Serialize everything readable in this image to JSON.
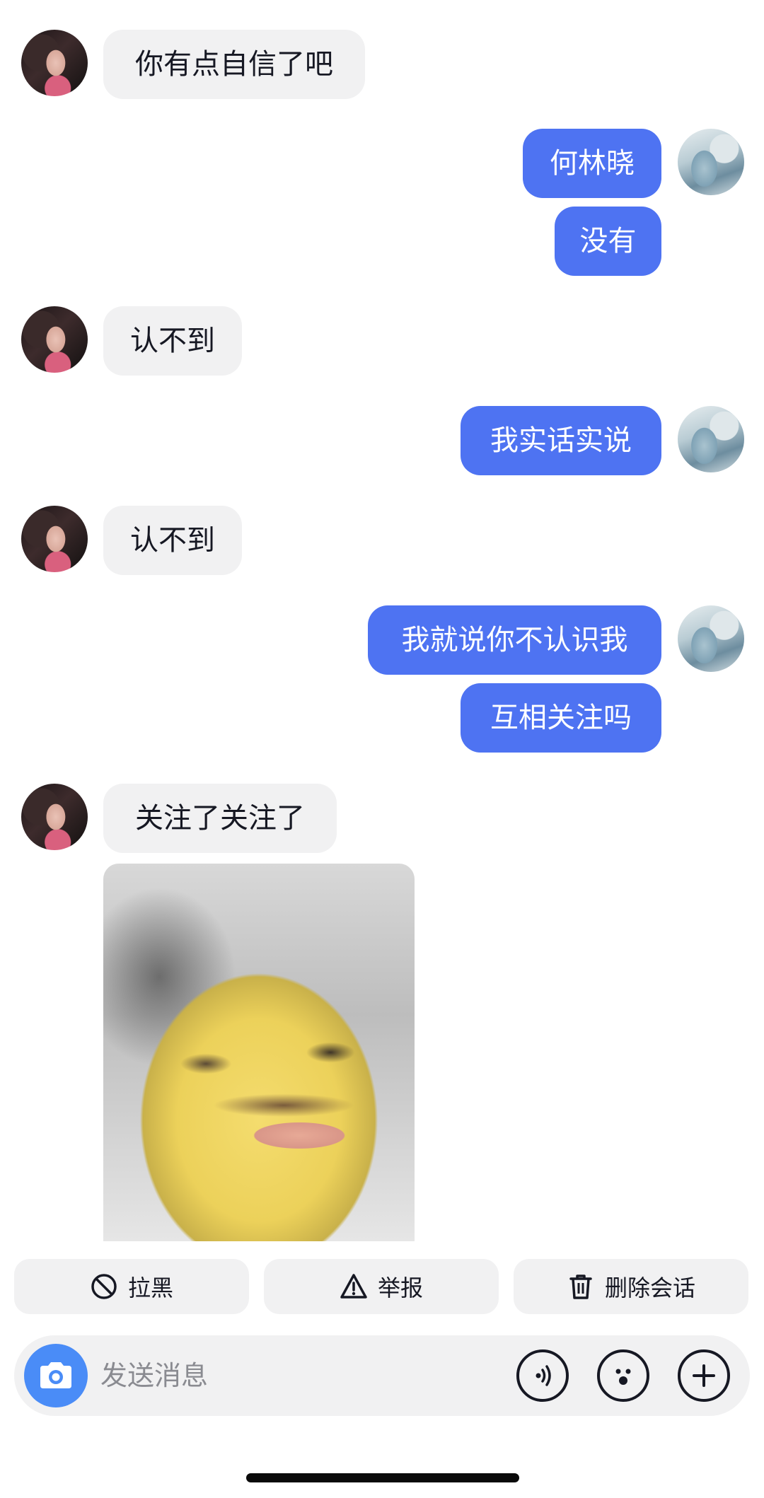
{
  "conversation": {
    "messages": [
      {
        "side": "in",
        "text": "你有点自信了吧"
      },
      {
        "side": "out",
        "text": "何林晓"
      },
      {
        "side": "out",
        "text": "没有"
      },
      {
        "side": "in",
        "text": "认不到"
      },
      {
        "side": "out",
        "text": "我实话实说"
      },
      {
        "side": "in",
        "text": "认不到"
      },
      {
        "side": "out",
        "text": "我就说你不认识我"
      },
      {
        "side": "out",
        "text": "互相关注吗"
      },
      {
        "side": "in",
        "text": "关注了关注了"
      }
    ],
    "sticker": {
      "icon": "yellow-face-sticker"
    }
  },
  "actions": {
    "block_label": "拉黑",
    "report_label": "举报",
    "delete_label": "删除会话"
  },
  "composer": {
    "placeholder": "发送消息"
  },
  "colors": {
    "outgoing_bubble": "#4e73f2",
    "incoming_bubble": "#f1f1f2",
    "camera_button": "#4a8cf7"
  }
}
